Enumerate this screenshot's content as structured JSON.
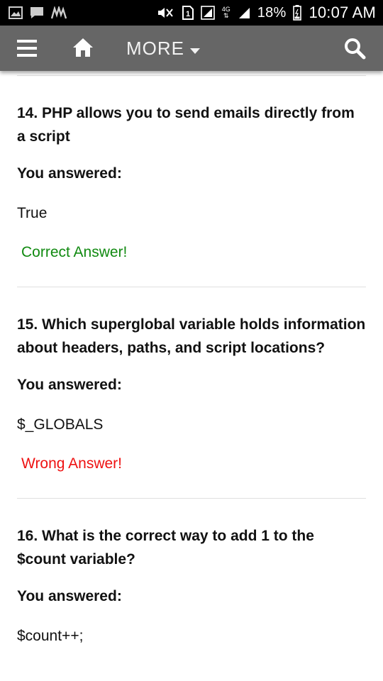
{
  "status_bar": {
    "left_icons": [
      "image-icon",
      "chat-icon",
      "signal-waves-icon"
    ],
    "right_icons": [
      "mute-icon",
      "sim-1-icon",
      "network-signal-icon",
      "4g-icon",
      "cell-signal-icon",
      "battery-icon"
    ],
    "network_type": "4G",
    "sim_number": "1",
    "battery_percent": "18%",
    "time": "10:07 AM"
  },
  "app_bar": {
    "menu_icon": "hamburger-menu-icon",
    "home_icon": "home-icon",
    "more_label": "MORE",
    "search_icon": "search-icon",
    "background_color": "#666666"
  },
  "questions": [
    {
      "text": "14. PHP allows you to send emails directly from a script",
      "you_answered_label": "You answered:",
      "answer": "True",
      "result": "Correct Answer!",
      "result_color": "#118a11"
    },
    {
      "text": "15. Which superglobal variable holds information about headers, paths, and script locations?",
      "you_answered_label": "You answered:",
      "answer": "$_GLOBALS",
      "result": "Wrong Answer!",
      "result_color": "#ee1111"
    },
    {
      "text": "16. What is the correct way to add 1 to the $count variable?",
      "you_answered_label": "You answered:",
      "answer": "$count++;"
    }
  ]
}
